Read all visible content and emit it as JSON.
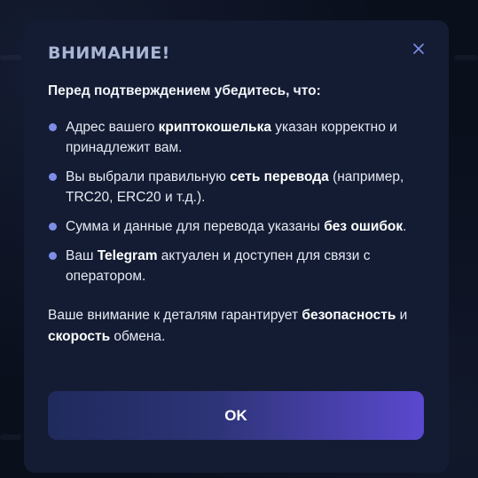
{
  "modal": {
    "title": "ВНИМАНИЕ!",
    "lead": "Перед подтверждением убедитесь, что:",
    "items": [
      {
        "pre": "Адрес вашего ",
        "bold": "криптокошелька",
        "post": " указан корректно и принадлежит вам."
      },
      {
        "pre": "Вы выбрали правильную ",
        "bold": "сеть перевода",
        "post": " (например, TRC20, ERC20 и т.д.)."
      },
      {
        "pre": "Сумма и данные для перевода указаны ",
        "bold": "без ошибок",
        "post": "."
      },
      {
        "pre": "Ваш ",
        "bold": "Telegram",
        "post": " актуален и доступен для связи с оператором."
      }
    ],
    "footer": {
      "pre": "Ваше внимание к деталям гарантирует ",
      "bold1": "безопасность",
      "mid": " и ",
      "bold2": "скорость",
      "post": " обмена."
    },
    "ok_label": "OK"
  },
  "colors": {
    "modal_bg": "#131c33",
    "bullet": "#7d8ee8",
    "title": "#aab6d6",
    "button_gradient_start": "#1f2a5c",
    "button_gradient_end": "#5b49cf"
  },
  "icons": {
    "close": "close-icon",
    "bullet": "bullet-dot-icon"
  }
}
